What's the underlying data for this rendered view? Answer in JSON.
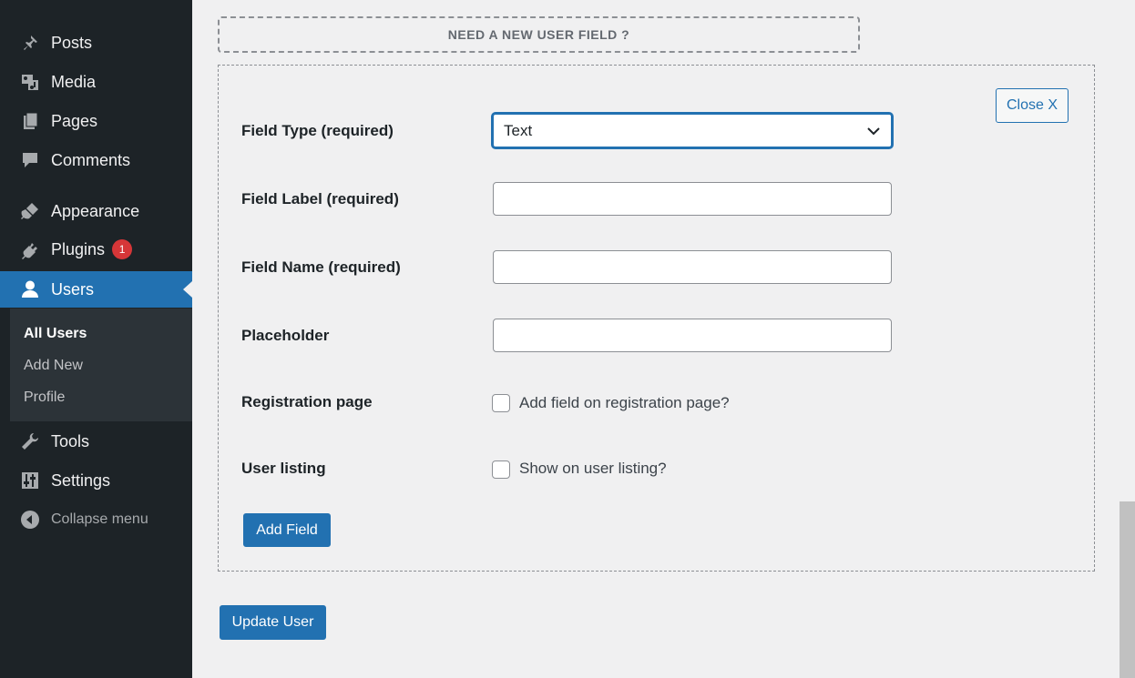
{
  "sidebar": {
    "items": [
      {
        "label": "Posts",
        "icon": "pin-icon"
      },
      {
        "label": "Media",
        "icon": "media-icon"
      },
      {
        "label": "Pages",
        "icon": "pages-icon"
      },
      {
        "label": "Comments",
        "icon": "comments-icon"
      },
      {
        "label": "Appearance",
        "icon": "brush-icon"
      },
      {
        "label": "Plugins",
        "icon": "plug-icon",
        "badge": "1"
      },
      {
        "label": "Users",
        "icon": "user-icon",
        "active": true
      },
      {
        "label": "Tools",
        "icon": "wrench-icon"
      },
      {
        "label": "Settings",
        "icon": "settings-icon"
      }
    ],
    "submenu": [
      "All Users",
      "Add New",
      "Profile"
    ],
    "collapse_label": "Collapse menu"
  },
  "main": {
    "need_field_label": "NEED A NEW USER FIELD ?",
    "close_label": "Close X",
    "form": {
      "field_type_label": "Field Type (required)",
      "field_type_value": "Text",
      "field_label_label": "Field Label (required)",
      "field_label_value": "",
      "field_name_label": "Field Name (required)",
      "field_name_value": "",
      "placeholder_label": "Placeholder",
      "placeholder_value": "",
      "registration_label": "Registration page",
      "registration_checkbox_label": "Add field on registration page?",
      "listing_label": "User listing",
      "listing_checkbox_label": "Show on user listing?",
      "add_field_label": "Add Field"
    },
    "update_user_label": "Update User"
  },
  "colors": {
    "sidebar_bg": "#1d2327",
    "accent": "#2271b1",
    "badge": "#d63638",
    "content_bg": "#f0f0f1"
  }
}
